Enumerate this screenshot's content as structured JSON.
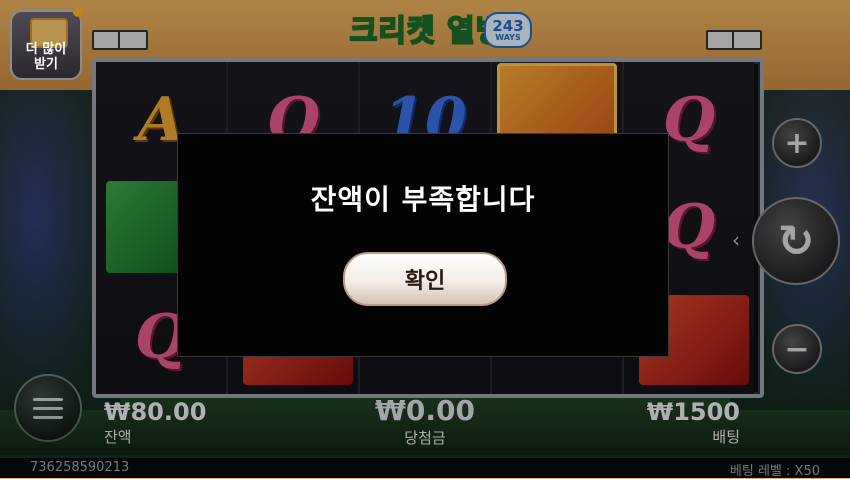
{
  "game": {
    "logo_title": "크리켓 열병",
    "logo_ways_number": "243",
    "logo_ways_label": "WAYS"
  },
  "more_button": {
    "label": "더 많이 받기"
  },
  "reels": [
    [
      "sym-a",
      "sym-bat",
      "sym-q"
    ],
    [
      "sym-q",
      "sym-blank",
      "sym-red"
    ],
    [
      "sym-10",
      "sym-blank",
      "sym-blank"
    ],
    [
      "sym-player",
      "sym-blank",
      "sym-blank"
    ],
    [
      "sym-q",
      "sym-q",
      "sym-red"
    ]
  ],
  "controls": {
    "plus_icon": "+",
    "minus_icon": "−",
    "spin_icon": "↻"
  },
  "stats": {
    "balance_value": "₩80.00",
    "balance_label": "잔액",
    "win_value": "₩0.00",
    "win_label": "당첨금",
    "bet_value": "₩1500",
    "bet_label": "배팅"
  },
  "footer": {
    "session_id": "736258590213",
    "bet_level": "베팅 레벨 : X50"
  },
  "dialog": {
    "message": "잔액이 부족합니다",
    "confirm_label": "확인"
  }
}
